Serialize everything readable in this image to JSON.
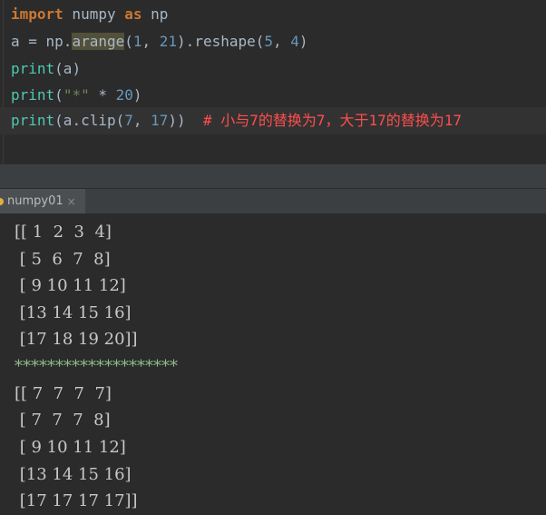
{
  "editor": {
    "lines": [
      {
        "segments": [
          {
            "t": "import",
            "c": "kw"
          },
          {
            "t": " numpy ",
            "c": "plain"
          },
          {
            "t": "as",
            "c": "kw"
          },
          {
            "t": " np",
            "c": "plain"
          }
        ]
      },
      {
        "segments": [
          {
            "t": "a = np.",
            "c": "plain"
          },
          {
            "t": "arange",
            "c": "plain hl"
          },
          {
            "t": "(",
            "c": "plain"
          },
          {
            "t": "1",
            "c": "num"
          },
          {
            "t": ", ",
            "c": "plain"
          },
          {
            "t": "21",
            "c": "num"
          },
          {
            "t": ").reshape(",
            "c": "plain"
          },
          {
            "t": "5",
            "c": "num"
          },
          {
            "t": ", ",
            "c": "plain"
          },
          {
            "t": "4",
            "c": "num"
          },
          {
            "t": ")",
            "c": "plain"
          }
        ]
      },
      {
        "segments": [
          {
            "t": "print",
            "c": "fn-cyan"
          },
          {
            "t": "(a)",
            "c": "plain"
          }
        ]
      },
      {
        "segments": [
          {
            "t": "print",
            "c": "fn-cyan"
          },
          {
            "t": "(",
            "c": "plain"
          },
          {
            "t": "\"*\"",
            "c": "str"
          },
          {
            "t": " * ",
            "c": "plain"
          },
          {
            "t": "20",
            "c": "num"
          },
          {
            "t": ")",
            "c": "plain"
          }
        ]
      },
      {
        "segments": [
          {
            "t": "print",
            "c": "fn-cyan"
          },
          {
            "t": "(a.clip(",
            "c": "plain"
          },
          {
            "t": "7",
            "c": "num"
          },
          {
            "t": ", ",
            "c": "plain"
          },
          {
            "t": "17",
            "c": "num"
          },
          {
            "t": "))  ",
            "c": "plain"
          },
          {
            "t": "# 小与7的替换为7，大于17的替换为17",
            "c": "comment"
          }
        ]
      }
    ]
  },
  "run_tab": {
    "label": "numpy01",
    "close_glyph": "×"
  },
  "console": {
    "lines": [
      "[[ 1  2  3  4]",
      " [ 5  6  7  8]",
      " [ 9 10 11 12]",
      " [13 14 15 16]",
      " [17 18 19 20]]",
      "********************",
      "[[ 7  7  7  7]",
      " [ 7  7  7  8]",
      " [ 9 10 11 12]",
      " [13 14 15 16]",
      " [17 17 17 17]]"
    ]
  },
  "colors": {
    "keyword": "#cc7832",
    "number": "#6897bb",
    "string": "#6a8759",
    "comment": "#ff4d4d",
    "builtin": "#4ec9b0",
    "background": "#2b2b2b"
  }
}
